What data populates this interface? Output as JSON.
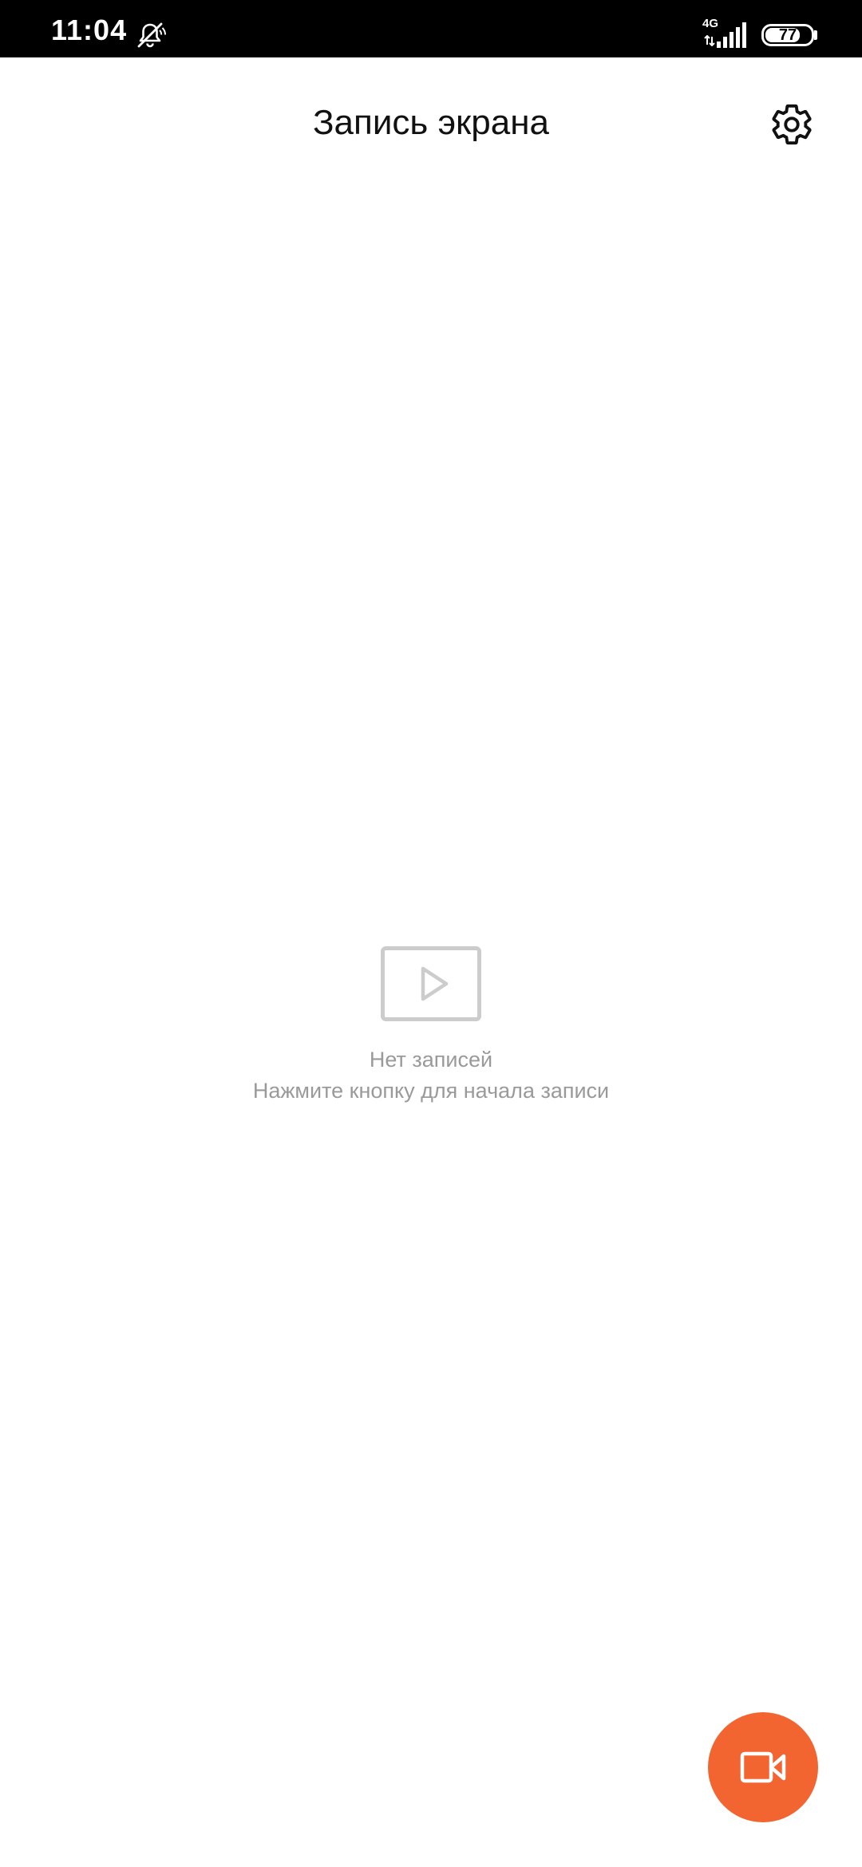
{
  "status_bar": {
    "time": "11:04",
    "network_type": "4G",
    "battery_level": "77",
    "battery_fraction": 0.77,
    "icons": [
      "mute-icon",
      "signal-icon",
      "battery-icon"
    ]
  },
  "header": {
    "title": "Запись экрана",
    "settings_icon": "gear-icon"
  },
  "empty_state": {
    "icon": "video-placeholder-icon",
    "title": "Нет записей",
    "hint": "Нажмите кнопку для начала записи"
  },
  "fab": {
    "icon": "video-camera-icon",
    "color": "#f26430"
  },
  "colors": {
    "accent": "#f26430",
    "muted_text": "#9a9a9a",
    "title_text": "#111111"
  }
}
